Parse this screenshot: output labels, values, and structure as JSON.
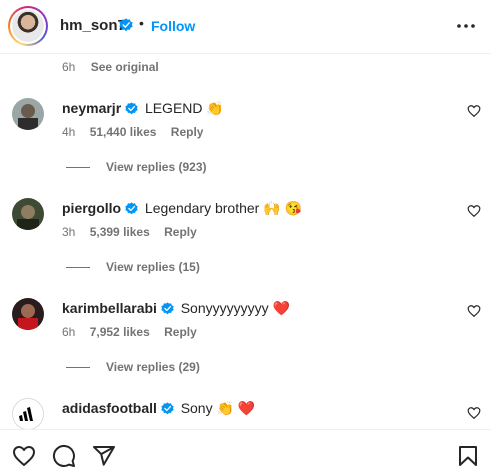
{
  "header": {
    "username": "hm_son7",
    "separator": "•",
    "follow_label": "Follow"
  },
  "caption_meta": {
    "time": "6h",
    "see_original": "See original"
  },
  "comments": [
    {
      "username": "neymarjr",
      "text": "LEGEND 👏",
      "time": "4h",
      "likes": "51,440 likes",
      "reply": "Reply",
      "replies": "View replies (923)"
    },
    {
      "username": "piergollo",
      "text": "Legendary brother 🙌 😘",
      "time": "3h",
      "likes": "5,399 likes",
      "reply": "Reply",
      "replies": "View replies (15)"
    },
    {
      "username": "karimbellarabi",
      "text": "Sonyyyyyyyyy ❤️",
      "time": "6h",
      "likes": "7,952 likes",
      "reply": "Reply",
      "replies": "View replies (29)"
    },
    {
      "username": "adidasfootball",
      "text": "Sony 👏 ❤️"
    }
  ],
  "icons": {
    "more": "more-horizontal-icon",
    "verified": "verified-badge-icon",
    "like": "heart-icon",
    "comment": "comment-icon",
    "share": "share-icon",
    "save": "bookmark-icon"
  },
  "colors": {
    "link": "#0095f6",
    "verified": "#0095f6",
    "muted": "#737373",
    "text": "#262626"
  }
}
